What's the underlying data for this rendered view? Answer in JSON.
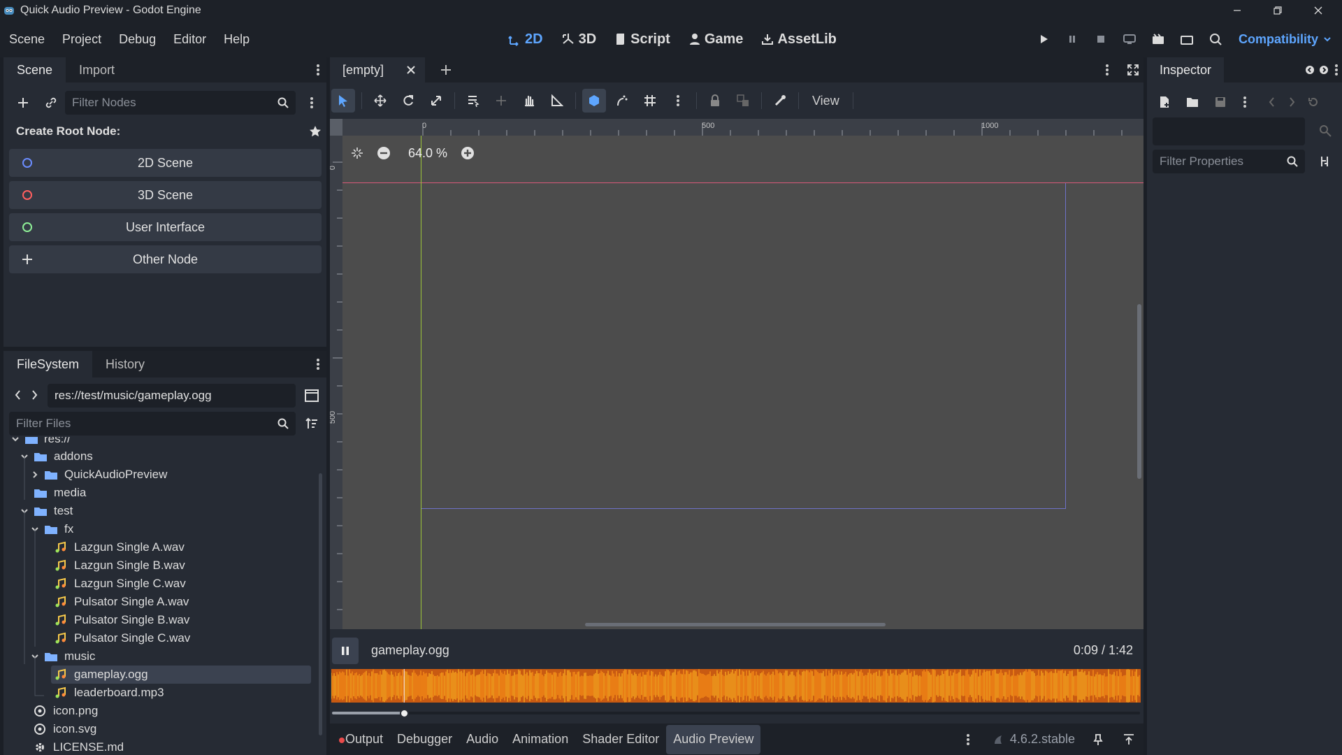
{
  "window": {
    "title": "Quick Audio Preview - Godot Engine"
  },
  "menu": [
    "Scene",
    "Project",
    "Debug",
    "Editor",
    "Help"
  ],
  "workspaces": [
    {
      "label": "2D",
      "icon": "2d-icon",
      "active": true
    },
    {
      "label": "3D",
      "icon": "3d-icon",
      "active": false
    },
    {
      "label": "Script",
      "icon": "script-icon",
      "active": false
    },
    {
      "label": "Game",
      "icon": "game-icon",
      "active": false
    },
    {
      "label": "AssetLib",
      "icon": "assetlib-icon",
      "active": false
    }
  ],
  "renderer": "Compatibility",
  "scene_dock": {
    "tabs": [
      "Scene",
      "Import"
    ],
    "filter_placeholder": "Filter Nodes",
    "create_root_label": "Create Root Node:",
    "nodes": [
      {
        "label": "2D Scene",
        "color": "#6b8cff"
      },
      {
        "label": "3D Scene",
        "color": "#ff5f5f"
      },
      {
        "label": "User Interface",
        "color": "#8eef97"
      },
      {
        "label": "Other Node",
        "color": "#e0e0e0"
      }
    ]
  },
  "filesystem": {
    "tabs": [
      "FileSystem",
      "History"
    ],
    "path": "res://test/music/gameplay.ogg",
    "filter_placeholder": "Filter Files",
    "root_label": "res://",
    "tree": [
      {
        "label": "addons",
        "type": "folder",
        "expanded": true
      },
      {
        "label": "QuickAudioPreview",
        "type": "folder",
        "expanded": false
      },
      {
        "label": "media",
        "type": "folder"
      },
      {
        "label": "test",
        "type": "folder",
        "expanded": true
      },
      {
        "label": "fx",
        "type": "folder",
        "expanded": true
      },
      {
        "label": "Lazgun Single A.wav",
        "type": "audio"
      },
      {
        "label": "Lazgun Single B.wav",
        "type": "audio"
      },
      {
        "label": "Lazgun Single C.wav",
        "type": "audio"
      },
      {
        "label": "Pulsator Single A.wav",
        "type": "audio"
      },
      {
        "label": "Pulsator Single B.wav",
        "type": "audio"
      },
      {
        "label": "Pulsator Single C.wav",
        "type": "audio"
      },
      {
        "label": "music",
        "type": "folder",
        "expanded": true
      },
      {
        "label": "gameplay.ogg",
        "type": "audio",
        "selected": true
      },
      {
        "label": "leaderboard.mp3",
        "type": "audio"
      },
      {
        "label": "icon.png",
        "type": "image"
      },
      {
        "label": "icon.svg",
        "type": "image"
      },
      {
        "label": "LICENSE.md",
        "type": "text"
      }
    ]
  },
  "editor": {
    "scene_tab": "[empty]",
    "view_label": "View",
    "zoom": "64.0 %",
    "ruler_h": [
      "0",
      "500",
      "1000"
    ],
    "ruler_v": [
      "0",
      "500"
    ]
  },
  "audio_preview": {
    "file": "gameplay.ogg",
    "time": "0:09 / 1:42",
    "progress": 0.09
  },
  "bottom_tabs": [
    "Output",
    "Debugger",
    "Audio",
    "Animation",
    "Shader Editor",
    "Audio Preview"
  ],
  "bottom_active": "Audio Preview",
  "version": "4.6.2.stable",
  "inspector": {
    "tab": "Inspector",
    "filter_placeholder": "Filter Properties"
  }
}
